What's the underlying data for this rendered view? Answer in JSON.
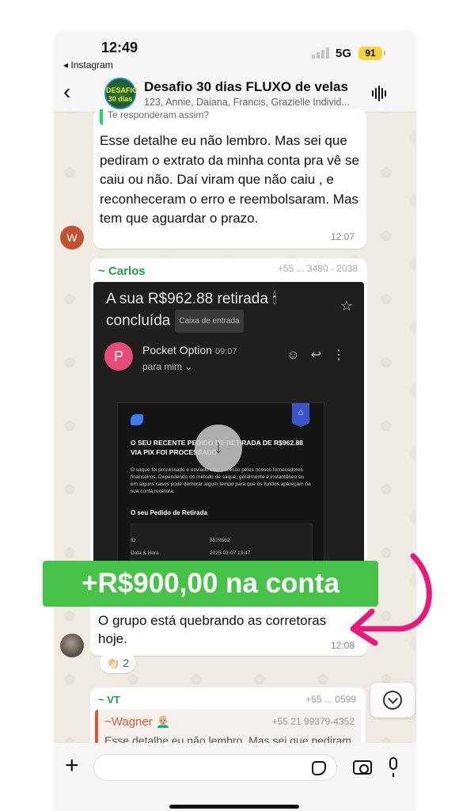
{
  "status": {
    "time": "12:49",
    "back_app": "◂ Instagram",
    "network": "5G",
    "battery": "91"
  },
  "header": {
    "avatar_text": "DESAFIO 30 dias",
    "title": "Desafio 30 dias FLUXO de velas",
    "subtitle": "123, Annie, Daiana, Francis, Grazielle Individ..."
  },
  "messages": {
    "m1": {
      "quote": "Te responderam assim?",
      "text": "Esse detalhe eu não lembro. Mas sei que pediram o extrato da minha conta pra vê se caiu ou não. Daí viram que não caiu , e reconheceram o erro e reembolsaram. Mas tem que aguardar o prazo.",
      "time": "12:07",
      "avatar": "W"
    },
    "m2": {
      "sender": "~ Carlos",
      "phone": "+55 ... 3480 - 2038",
      "caption": "O grupo está quebrando as corretoras hoje.",
      "time": "12:08",
      "reaction_emoji": "👏🏻",
      "reaction_count": "2"
    },
    "m3": {
      "sender": "~ VT",
      "phone": "+55 ... 0599",
      "quote_name": "~Wagner 👨🏼‍🦲",
      "quote_phone": "+55 21 99379-4352",
      "quote_text": "Esse detalhe eu não lembro. Mas sei que pediram"
    }
  },
  "email": {
    "subject": "A sua R$962.88 retirada 🕯 concluída",
    "inbox_chip": "Caixa de entrada",
    "avatar": "P",
    "from": "Pocket Option",
    "from_time": "09:07",
    "to": "para mim ⌄",
    "heading": "O SEU RECENTE PEDIDO DE RETIRADA DE R$962.88 VIA PIX FOI PROCESSADO",
    "body": "O saque foi processado e enviado com sucesso pelos nossos fornecedores financeiros. Dependendo do método de saque, geralmente é instantâneo ou em alguns casos pode demorar algum tempo para que os fundos apareçam na sua conta recetora.",
    "subheading": "O seu Pedido de Retirada",
    "rows": [
      {
        "label": "ID",
        "value": "8579562"
      },
      {
        "label": "Data & Hora",
        "value": "2025-02-07 13:47"
      }
    ]
  },
  "overlay": {
    "label": "+R$900,00 na conta",
    "arrow_color": "#e8197c",
    "label_color": "#45c247"
  },
  "icons": [
    "back-chevron-icon",
    "voice-wave-icon",
    "download-icon",
    "scroll-down-icon",
    "plus-icon",
    "sticker-icon",
    "camera-icon",
    "mic-icon",
    "star-icon",
    "emoji-icon",
    "reply-icon",
    "more-icon"
  ]
}
